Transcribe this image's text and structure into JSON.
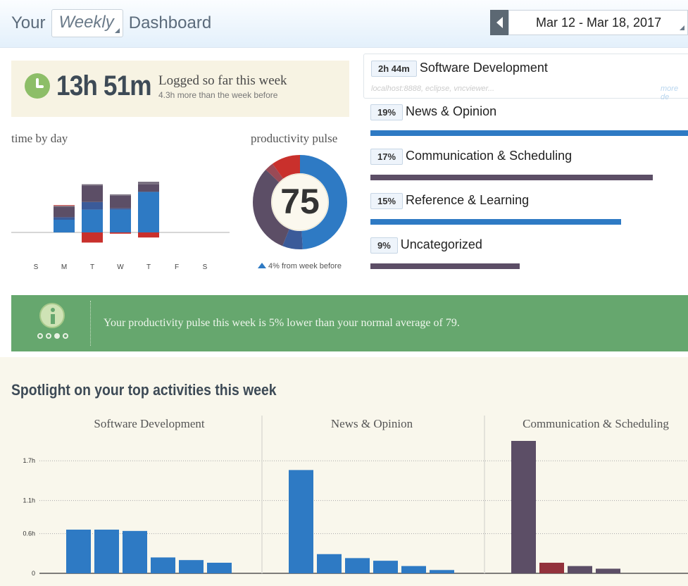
{
  "header": {
    "title_prefix": "Your",
    "period": "Weekly",
    "title_suffix": "Dashboard",
    "date_range": "Mar 12 - Mar 18, 2017"
  },
  "summary": {
    "logged_time": "13h 51m",
    "logged_label": "Logged so far this week",
    "logged_sub": "4.3h more than the week before"
  },
  "time_by_day": {
    "title": "time by day",
    "days": [
      "S",
      "M",
      "T",
      "W",
      "T",
      "F",
      "S"
    ]
  },
  "pulse": {
    "title": "productivity pulse",
    "value": "75",
    "note": "4% from week before"
  },
  "categories": {
    "top": {
      "time": "2h 44m",
      "name": "Software Development",
      "sub": "localhost:8888, eclipse, vncviewer...",
      "more": "more de"
    },
    "items": [
      {
        "pct": "19%",
        "name": "News & Opinion",
        "fraction": 1.0,
        "color": "#2e7ac4"
      },
      {
        "pct": "17%",
        "name": "Communication & Scheduling",
        "fraction": 0.89,
        "color": "#5c4e66"
      },
      {
        "pct": "15%",
        "name": "Reference & Learning",
        "fraction": 0.79,
        "color": "#2e7ac4"
      },
      {
        "pct": "9%",
        "name": "Uncategorized",
        "fraction": 0.47,
        "color": "#5c4e66"
      }
    ]
  },
  "banner": {
    "text": "Your productivity pulse this week is 5% lower than your normal average of 79."
  },
  "spotlight": {
    "title": "Spotlight on your top activities this week"
  },
  "chart_data": [
    {
      "type": "bar",
      "title": "time by day",
      "categories": [
        "S",
        "M",
        "T",
        "W",
        "T",
        "F",
        "S"
      ],
      "stacked": true,
      "series": [
        {
          "color": "#2e7ac4",
          "values": [
            0,
            1.0,
            1.8,
            1.8,
            3.2,
            0,
            0
          ]
        },
        {
          "color": "#3b5b99",
          "values": [
            0,
            0.2,
            0.6,
            0.1,
            0,
            0,
            0
          ]
        },
        {
          "color": "#5c4e66",
          "values": [
            0,
            0.8,
            1.3,
            1.0,
            0.6,
            0,
            0
          ]
        },
        {
          "color": "#7a7181",
          "values": [
            0,
            0.1,
            0.1,
            0.1,
            0.2,
            0,
            0
          ]
        },
        {
          "color": "#c9302c",
          "values": [
            0,
            0.05,
            -0.8,
            -0.1,
            -0.4,
            0,
            0
          ]
        }
      ]
    },
    {
      "type": "pie",
      "title": "productivity pulse",
      "slices": [
        {
          "value": 49,
          "color": "#2e7ac4"
        },
        {
          "value": 7,
          "color": "#3b5b99"
        },
        {
          "value": 31,
          "color": "#5c4e66"
        },
        {
          "value": 3,
          "color": "#9a4a56"
        },
        {
          "value": 10,
          "color": "#c9302c"
        }
      ]
    },
    {
      "type": "bar",
      "title": "Software Development",
      "ylim": [
        0,
        2.0
      ],
      "yticks": [
        "0",
        "0.6h",
        "1.1h",
        "1.7h"
      ],
      "ytick_values": [
        0,
        0.6,
        1.1,
        1.7
      ],
      "values": [
        0.66,
        0.66,
        0.64,
        0.24,
        0.2,
        0.16
      ],
      "colors": [
        "#2e7ac4",
        "#2e7ac4",
        "#2e7ac4",
        "#2e7ac4",
        "#2e7ac4",
        "#2e7ac4"
      ]
    },
    {
      "type": "bar",
      "title": "News & Opinion",
      "ylim": [
        0,
        2.0
      ],
      "values": [
        1.56,
        0.29,
        0.23,
        0.19,
        0.11,
        0.05
      ],
      "colors": [
        "#2e7ac4",
        "#2e7ac4",
        "#2e7ac4",
        "#2e7ac4",
        "#2e7ac4",
        "#2e7ac4"
      ]
    },
    {
      "type": "bar",
      "title": "Communication & Scheduling",
      "ylim": [
        0,
        2.0
      ],
      "values": [
        2.0,
        0.16,
        0.11,
        0.07
      ],
      "colors": [
        "#5c4e66",
        "#93323c",
        "#5c4e66",
        "#5c4e66"
      ]
    }
  ]
}
